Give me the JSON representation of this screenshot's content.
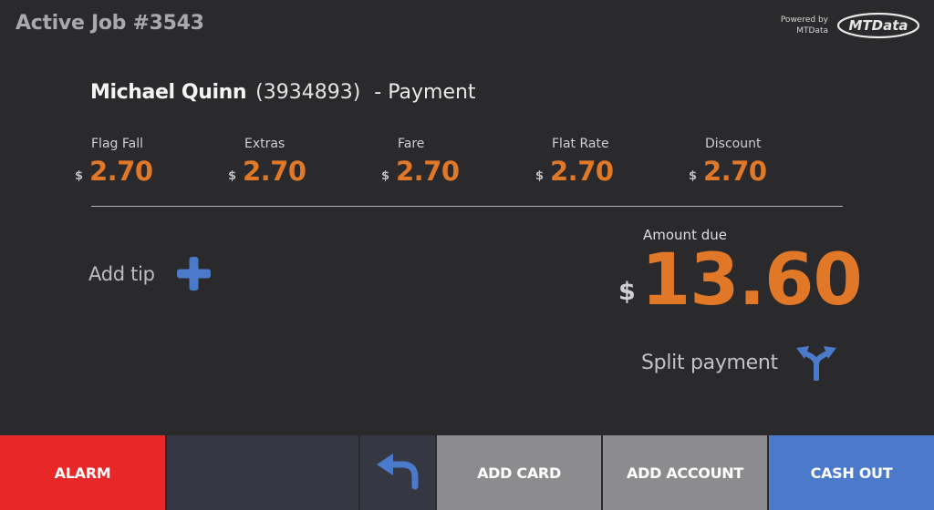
{
  "header": {
    "title": "Active Job #3543",
    "powered_by_line1": "Powered by",
    "powered_by_line2": "MTData",
    "logo_text": "MTData"
  },
  "customer": {
    "name": "Michael Quinn",
    "id": "(3934893)",
    "suffix": "- Payment"
  },
  "fees": [
    {
      "label": "Flag Fall",
      "currency": "$",
      "value": "2.70"
    },
    {
      "label": "Extras",
      "currency": "$",
      "value": "2.70"
    },
    {
      "label": "Fare",
      "currency": "$",
      "value": "2.70"
    },
    {
      "label": "Flat Rate",
      "currency": "$",
      "value": "2.70"
    },
    {
      "label": "Discount",
      "currency": "$",
      "value": "2.70"
    }
  ],
  "tip": {
    "label": "Add tip",
    "icon": "plus-icon"
  },
  "amount_due": {
    "label": "Amount due",
    "currency": "$",
    "value": "13.60"
  },
  "split": {
    "label": "Split payment",
    "icon": "split-arrows-icon"
  },
  "buttons": {
    "alarm": "ALARM",
    "back_icon": "undo-icon",
    "add_card": "ADD CARD",
    "add_account": "ADD ACCOUNT",
    "cash_out": "CASH OUT"
  },
  "colors": {
    "background": "#2a2a2c",
    "accent_orange": "#e07828",
    "accent_blue": "#4a7ac9",
    "alarm_red": "#e82828",
    "button_grey": "#8c8c8e",
    "button_dark": "#353842"
  }
}
